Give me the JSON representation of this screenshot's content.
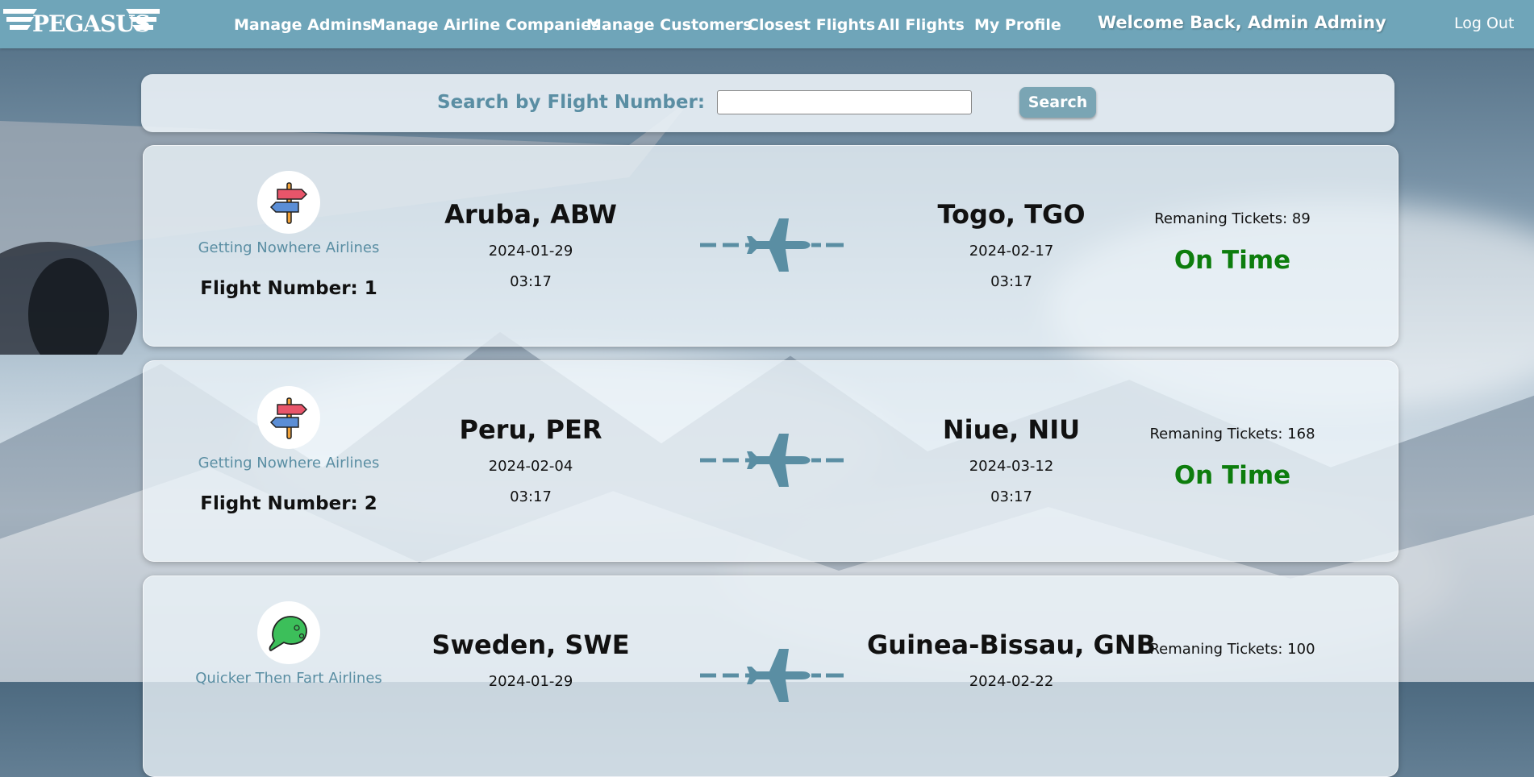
{
  "nav": {
    "logo_text": "PEGASUS",
    "links": [
      {
        "label": "Manage Admins"
      },
      {
        "label": "Manage Airline Companies"
      },
      {
        "label": "Manage Customers"
      },
      {
        "label": "Closest Flights"
      },
      {
        "label": "All Flights"
      },
      {
        "label": "My Profile"
      }
    ],
    "welcome": "Welcome Back, Admin Adminy",
    "logout": "Log Out"
  },
  "search": {
    "label": "Search by Flight Number:",
    "value": "",
    "button": "Search"
  },
  "flights": [
    {
      "airline": "Getting Nowhere Airlines",
      "airline_icon": "signpost-icon",
      "flight_number": "Flight Number: 1",
      "origin": "Aruba, ABW",
      "departure_date": "2024-01-29",
      "departure_time": "03:17",
      "destination": "Togo, TGO",
      "arrival_date": "2024-02-17",
      "arrival_time": "03:17",
      "tickets": "Remaning Tickets: 89",
      "status": "On Time"
    },
    {
      "airline": "Getting Nowhere Airlines",
      "airline_icon": "signpost-icon",
      "flight_number": "Flight Number: 2",
      "origin": "Peru, PER",
      "departure_date": "2024-02-04",
      "departure_time": "03:17",
      "destination": "Niue, NIU",
      "arrival_date": "2024-03-12",
      "arrival_time": "03:17",
      "tickets": "Remaning Tickets: 168",
      "status": "On Time"
    },
    {
      "airline": "Quicker Then Fart Airlines",
      "airline_icon": "green-cap-icon",
      "flight_number": "",
      "origin": "Sweden, SWE",
      "departure_date": "2024-01-29",
      "departure_time": "",
      "destination": "Guinea-Bissau, GNB",
      "arrival_date": "2024-02-22",
      "arrival_time": "",
      "tickets": "Remaning Tickets: 100",
      "status": ""
    }
  ],
  "colors": {
    "navbar": "#6fa5b9",
    "accent_text": "#5a8ea3",
    "status_on_time": "#0d7d0d",
    "plane": "#5a8ea3"
  }
}
